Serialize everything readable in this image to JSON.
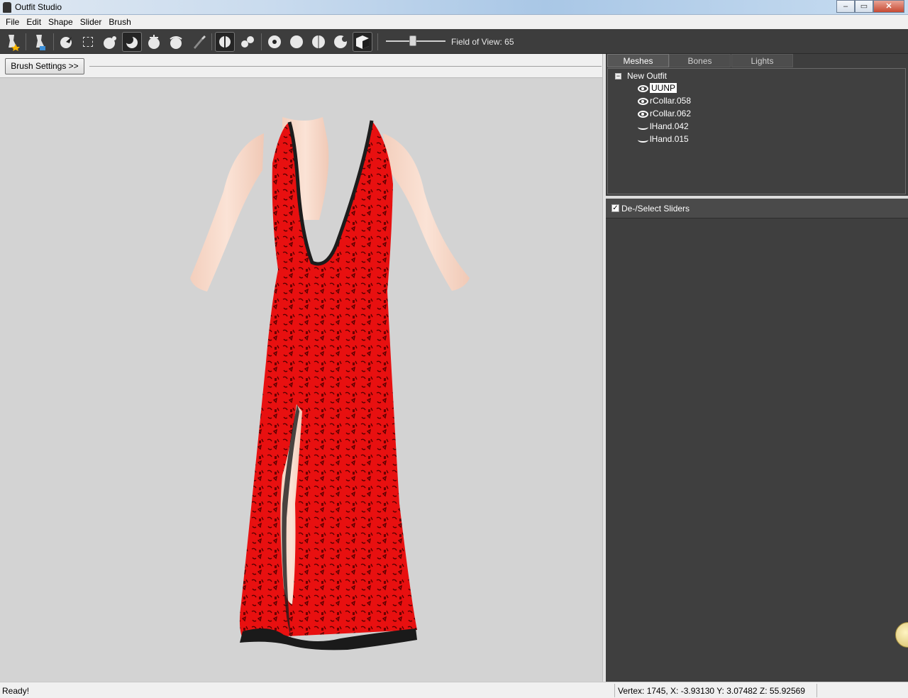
{
  "window": {
    "title": "Outfit Studio",
    "subtitle_faded": "[blurred]",
    "controls": {
      "minimize": "‒",
      "maximize": "▭",
      "close": "✕"
    }
  },
  "menu": {
    "items": [
      "File",
      "Edit",
      "Shape",
      "Slider",
      "Brush"
    ]
  },
  "toolbar": {
    "field_of_view_label": "Field of View: 65",
    "field_of_view_level": 0.45
  },
  "brush_settings": {
    "label": "Brush Settings >>"
  },
  "tabs": {
    "meshes": "Meshes",
    "bones": "Bones",
    "lights": "Lights"
  },
  "mesh_tree": {
    "root": "New Outfit",
    "toggle": "−",
    "items": [
      {
        "label": "UUNP",
        "visible": true,
        "selected": true
      },
      {
        "label": "rCollar.058",
        "visible": true,
        "selected": false
      },
      {
        "label": "rCollar.062",
        "visible": true,
        "selected": false
      },
      {
        "label": "lHand.042",
        "visible": false,
        "selected": false
      },
      {
        "label": "lHand.015",
        "visible": false,
        "selected": false
      }
    ]
  },
  "sliders": {
    "checkbox_mark": "✓",
    "label": "De-/Select Sliders"
  },
  "status": {
    "left": "Ready!",
    "right": "Vertex: 1745, X: -3.93130 Y: 3.07482 Z: 55.92569"
  },
  "colors": {
    "toolbar_bg": "#3d3d3d",
    "viewport_bg": "#d3d3d3",
    "panel_bg": "#3e3e3e",
    "dress_red": "#e81010",
    "skin": "#f6d6c4"
  }
}
